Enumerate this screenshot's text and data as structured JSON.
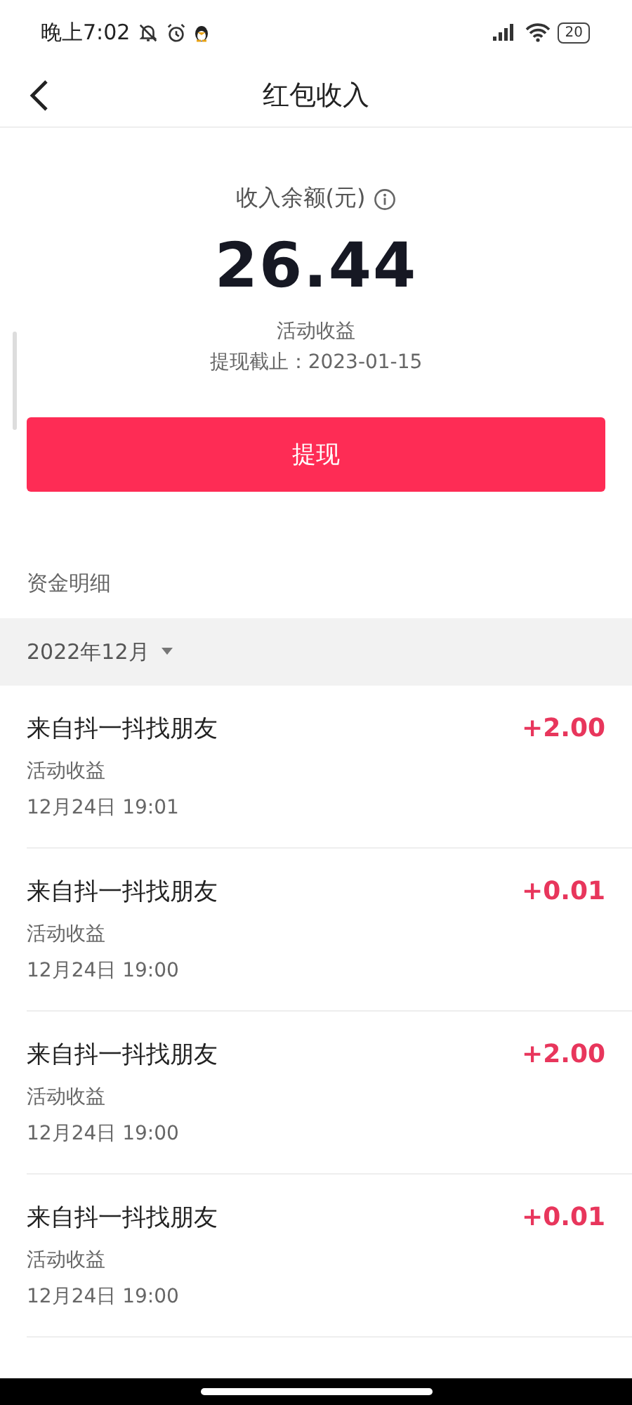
{
  "status_bar": {
    "time": "晚上7:02",
    "battery": "20"
  },
  "header": {
    "title": "红包收入"
  },
  "summary": {
    "label": "收入余额(元)",
    "amount": "26.44",
    "source": "活动收益",
    "deadline": "提现截止：2023-01-15"
  },
  "withdraw_button": "提现",
  "section_title": "资金明细",
  "month_filter": "2022年12月",
  "records": [
    {
      "title": "来自抖一抖找朋友",
      "type": "活动收益",
      "time": "12月24日 19:01",
      "amount": "+2.00"
    },
    {
      "title": "来自抖一抖找朋友",
      "type": "活动收益",
      "time": "12月24日 19:00",
      "amount": "+0.01"
    },
    {
      "title": "来自抖一抖找朋友",
      "type": "活动收益",
      "time": "12月24日 19:00",
      "amount": "+2.00"
    },
    {
      "title": "来自抖一抖找朋友",
      "type": "活动收益",
      "time": "12月24日 19:00",
      "amount": "+0.01"
    }
  ]
}
